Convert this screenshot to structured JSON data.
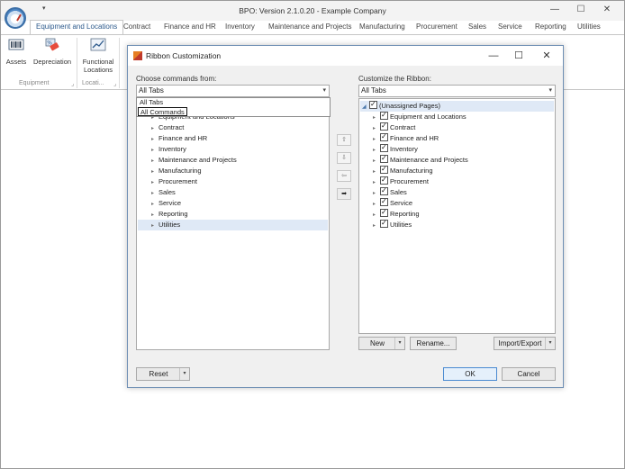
{
  "app": {
    "title": "BPO: Version 2.1.0.20 - Example Company",
    "qat_arrow": "▾",
    "controls": {
      "minimize": "—",
      "maximize": "☐",
      "close": "✕"
    }
  },
  "tabs": [
    {
      "label": "Equipment and Locations",
      "active": true
    },
    {
      "label": "Contract"
    },
    {
      "label": "Finance and HR"
    },
    {
      "label": "Inventory"
    },
    {
      "label": "Maintenance and Projects"
    },
    {
      "label": "Manufacturing"
    },
    {
      "label": "Procurement"
    },
    {
      "label": "Sales"
    },
    {
      "label": "Service"
    },
    {
      "label": "Reporting"
    },
    {
      "label": "Utilities"
    }
  ],
  "ribbon": {
    "assets_label": "Assets",
    "depreciation_label": "Depreciation",
    "functional_locations_line1": "Functional",
    "functional_locations_line2": "Locations",
    "group_equipment": "Equipment",
    "group_locations": "Locati...",
    "group_corner": "⌟"
  },
  "dialog": {
    "title": "Ribbon Customization",
    "controls": {
      "minimize": "—",
      "maximize": "☐",
      "close": "✕"
    },
    "choose_label": "Choose commands from:",
    "choose_value": "All Tabs",
    "dropdown_options": [
      "All Tabs",
      "All Commands"
    ],
    "customize_label": "Customize the Ribbon:",
    "customize_value": "All Tabs",
    "combo_arrow": "▾",
    "left_tree": [
      "Equipment and Locations",
      "Contract",
      "Finance and HR",
      "Inventory",
      "Maintenance and Projects",
      "Manufacturing",
      "Procurement",
      "Sales",
      "Service",
      "Reporting",
      "Utilities"
    ],
    "right_root": "(Unassigned Pages)",
    "right_tree": [
      "Equipment and Locations",
      "Contract",
      "Finance and HR",
      "Inventory",
      "Maintenance and Projects",
      "Manufacturing",
      "Procurement",
      "Sales",
      "Service",
      "Reporting",
      "Utilities"
    ],
    "move_buttons": [
      "⇧",
      "⇩",
      "⇦",
      "➡"
    ],
    "new_label": "New",
    "rename_label": "Rename...",
    "import_export_label": "Import/Export",
    "reset_label": "Reset",
    "ok_label": "OK",
    "cancel_label": "Cancel",
    "split_arrow": "▾",
    "expand_glyph": "▸",
    "collapse_glyph": "◢"
  },
  "colors": {
    "accent": "#2d5a8c",
    "dialog_border": "#6f8fb4",
    "selection": "#dfe9f6"
  }
}
